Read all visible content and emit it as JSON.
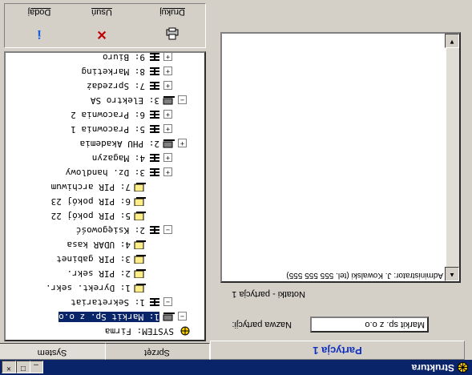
{
  "window": {
    "title": "Struktura",
    "buttons": {
      "minimize": "_",
      "maximize": "□",
      "close": "×"
    }
  },
  "left_panel": {
    "tabs": [
      "System",
      "Sprzęt"
    ],
    "tree": [
      {
        "label": "SYSTEM: Firma",
        "icon": "system-icon",
        "expander": ""
      },
      {
        "label": "1: Markit Sp. z o.o",
        "icon": "company-icon",
        "expander": "−",
        "selected": true
      },
      {
        "label": "1: Sekretariat",
        "icon": "department-icon",
        "expander": "−"
      },
      {
        "label": "1: Dyrekt. sekr.",
        "icon": "workstation-icon",
        "expander": ""
      },
      {
        "label": "2: PIR sekr.",
        "icon": "workstation-icon",
        "expander": ""
      },
      {
        "label": "3: PIR gabinet",
        "icon": "workstation-icon",
        "expander": ""
      },
      {
        "label": "4: UDAR kasa",
        "icon": "workstation-icon",
        "expander": ""
      },
      {
        "label": "2: Księgowość",
        "icon": "department-icon",
        "expander": "−"
      },
      {
        "label": "5: PIR pokój 22",
        "icon": "workstation-icon",
        "expander": ""
      },
      {
        "label": "6: PIR pokój 23",
        "icon": "workstation-icon",
        "expander": ""
      },
      {
        "label": "7: PIR archiwum",
        "icon": "workstation-off-icon",
        "expander": ""
      },
      {
        "label": "3: Dz. handlowy",
        "icon": "department-icon",
        "expander": "+"
      },
      {
        "label": "4: Magazyn",
        "icon": "department-icon",
        "expander": "+"
      },
      {
        "label": "2: PHU Akademia",
        "icon": "company-icon",
        "expander": "+"
      },
      {
        "label": "5: Pracownia 1",
        "icon": "department-icon",
        "expander": "+"
      },
      {
        "label": "6: Pracownia 2",
        "icon": "department-icon",
        "expander": "+"
      },
      {
        "label": "3: Elektro SA",
        "icon": "company-icon",
        "expander": "−"
      },
      {
        "label": "7: Sprzedaż",
        "icon": "department-icon",
        "expander": "+"
      },
      {
        "label": "8: Marketing",
        "icon": "department-icon",
        "expander": "+"
      },
      {
        "label": "9: Biuro",
        "icon": "department-icon",
        "expander": "+"
      }
    ],
    "toolbar": {
      "add_label": "Dodaj",
      "delete_label": "Usuń",
      "print_label": "Drukuj"
    }
  },
  "right_panel": {
    "title": "Partycja 1",
    "name_label": "Nazwa partycji:",
    "name_value": "Markit sp. z o.o",
    "notes_title": "Notatki - partycja 1",
    "notes_text": "Administrator: J. Kowalski (tel. 555 555 555)"
  }
}
